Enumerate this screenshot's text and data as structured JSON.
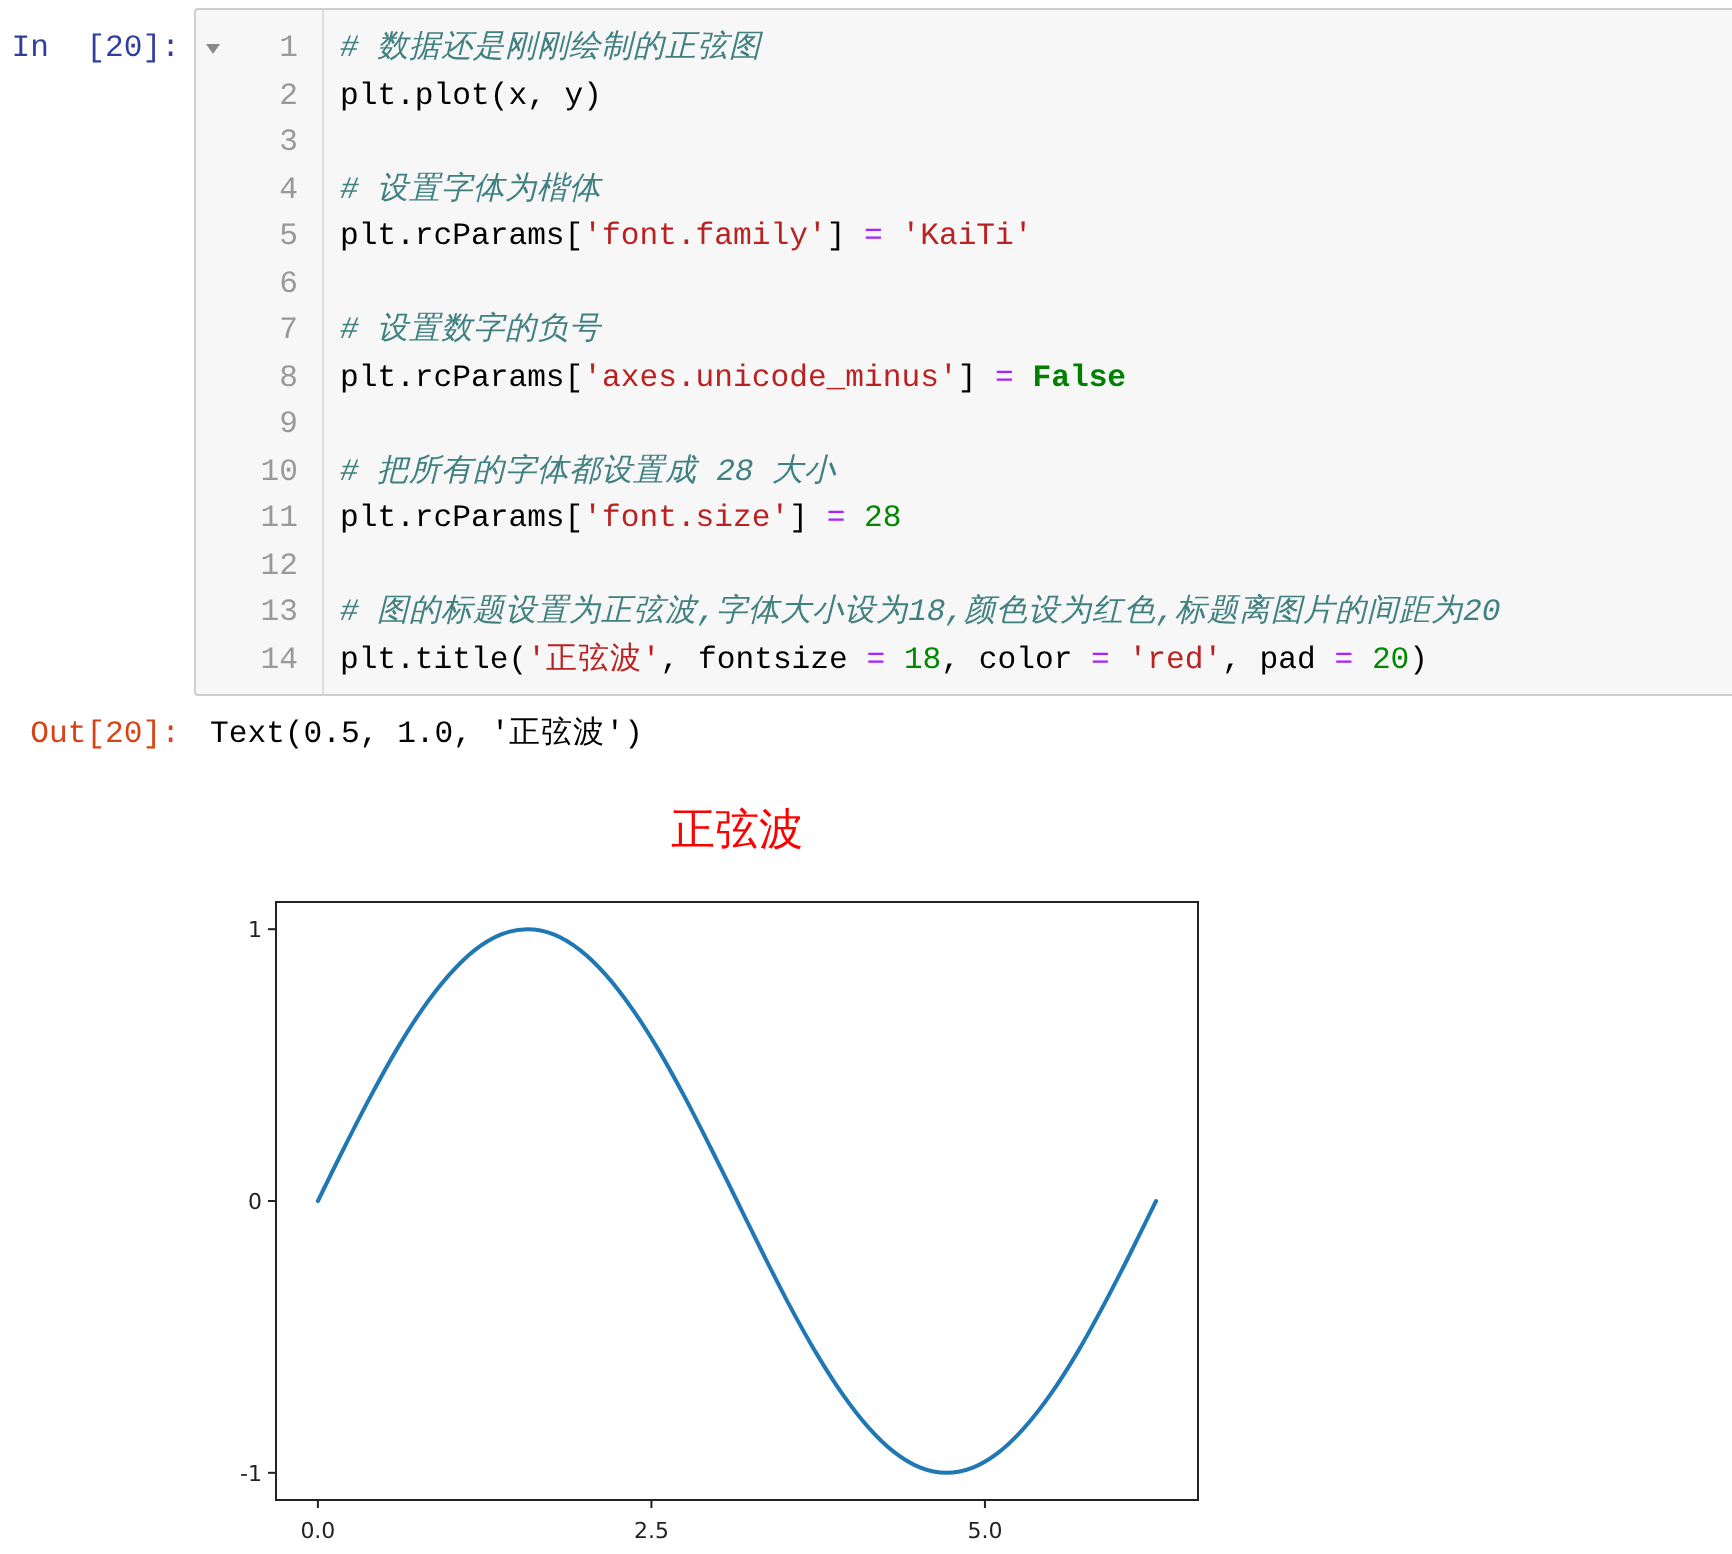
{
  "input_cell": {
    "prompt": "In  [20]:",
    "fold_marker": {
      "expanded": true
    },
    "lines": [
      {
        "number": "1",
        "tokens": [
          {
            "kind": "comment",
            "text": "# 数据还是刚刚绘制的正弦图"
          }
        ]
      },
      {
        "number": "2",
        "tokens": [
          {
            "kind": "plain",
            "text": "plt.plot(x, y)"
          }
        ]
      },
      {
        "number": "3"
      },
      {
        "number": "4",
        "tokens": [
          {
            "kind": "comment",
            "text": "# 设置字体为楷体"
          }
        ]
      },
      {
        "number": "5",
        "tokens": [
          {
            "kind": "plain",
            "text": "plt.rcParams["
          },
          {
            "kind": "string",
            "text": "'font.family'"
          },
          {
            "kind": "plain",
            "text": "] "
          },
          {
            "kind": "operator",
            "text": "= "
          },
          {
            "kind": "string",
            "text": "'KaiTi'"
          }
        ]
      },
      {
        "number": "6"
      },
      {
        "number": "7",
        "tokens": [
          {
            "kind": "comment",
            "text": "# 设置数字的负号"
          }
        ]
      },
      {
        "number": "8",
        "tokens": [
          {
            "kind": "plain",
            "text": "plt.rcParams["
          },
          {
            "kind": "string",
            "text": "'axes.unicode_minus'"
          },
          {
            "kind": "plain",
            "text": "] "
          },
          {
            "kind": "operator",
            "text": "= "
          },
          {
            "kind": "keyword",
            "text": "False"
          }
        ]
      },
      {
        "number": "9"
      },
      {
        "number": "10",
        "tokens": [
          {
            "kind": "comment",
            "text": "# 把所有的字体都设置成 28 大小"
          }
        ]
      },
      {
        "number": "11",
        "tokens": [
          {
            "kind": "plain",
            "text": "plt.rcParams["
          },
          {
            "kind": "string",
            "text": "'font.size'"
          },
          {
            "kind": "plain",
            "text": "] "
          },
          {
            "kind": "operator",
            "text": "= "
          },
          {
            "kind": "number",
            "text": "28"
          }
        ]
      },
      {
        "number": "12"
      },
      {
        "number": "13",
        "tokens": [
          {
            "kind": "comment",
            "text": "# 图的标题设置为正弦波,字体大小设为18,颜色设为红色,标题离图片的间距为20"
          }
        ]
      },
      {
        "number": "14",
        "tokens": [
          {
            "kind": "plain",
            "text": "plt.title("
          },
          {
            "kind": "string",
            "text": "'正弦波'"
          },
          {
            "kind": "plain",
            "text": ", fontsize "
          },
          {
            "kind": "operator",
            "text": "= "
          },
          {
            "kind": "number",
            "text": "18"
          },
          {
            "kind": "plain",
            "text": ", color "
          },
          {
            "kind": "operator",
            "text": "= "
          },
          {
            "kind": "string",
            "text": "'red'"
          },
          {
            "kind": "plain",
            "text": ", pad "
          },
          {
            "kind": "operator",
            "text": "= "
          },
          {
            "kind": "number",
            "text": "20"
          },
          {
            "kind": "plain",
            "text": ")"
          }
        ]
      }
    ]
  },
  "output_cell": {
    "prompt": "Out[20]:",
    "text": "Text(0.5, 1.0, '正弦波')",
    "chart_data": {
      "type": "line",
      "title": "正弦波",
      "x": [
        0,
        0.196,
        0.393,
        0.589,
        0.785,
        0.982,
        1.178,
        1.374,
        1.571,
        1.767,
        1.963,
        2.16,
        2.356,
        2.553,
        2.749,
        2.945,
        3.142,
        3.338,
        3.534,
        3.731,
        3.927,
        4.123,
        4.32,
        4.516,
        4.712,
        4.909,
        5.105,
        5.301,
        5.498,
        5.694,
        5.89,
        6.087,
        6.283
      ],
      "series": [
        {
          "color": "#1f77b4",
          "values": [
            0,
            0.195,
            0.383,
            0.556,
            0.707,
            0.831,
            0.924,
            0.981,
            1,
            0.981,
            0.924,
            0.831,
            0.707,
            0.556,
            0.383,
            0.195,
            0,
            -0.195,
            -0.383,
            -0.556,
            -0.707,
            -0.831,
            -0.924,
            -0.981,
            -1,
            -0.981,
            -0.924,
            -0.831,
            -0.707,
            -0.556,
            -0.383,
            -0.195,
            0
          ]
        }
      ],
      "xlim": [
        -0.314,
        6.597
      ],
      "ylim": [
        -1.1,
        1.1
      ],
      "xticks": [
        {
          "value": 0,
          "label": "0.0"
        },
        {
          "value": 2.5,
          "label": "2.5"
        },
        {
          "value": 5,
          "label": "5.0"
        }
      ],
      "yticks": [
        {
          "value": -1,
          "label": "-1"
        },
        {
          "value": 0,
          "label": "0"
        },
        {
          "value": 1,
          "label": "1"
        }
      ]
    }
  }
}
